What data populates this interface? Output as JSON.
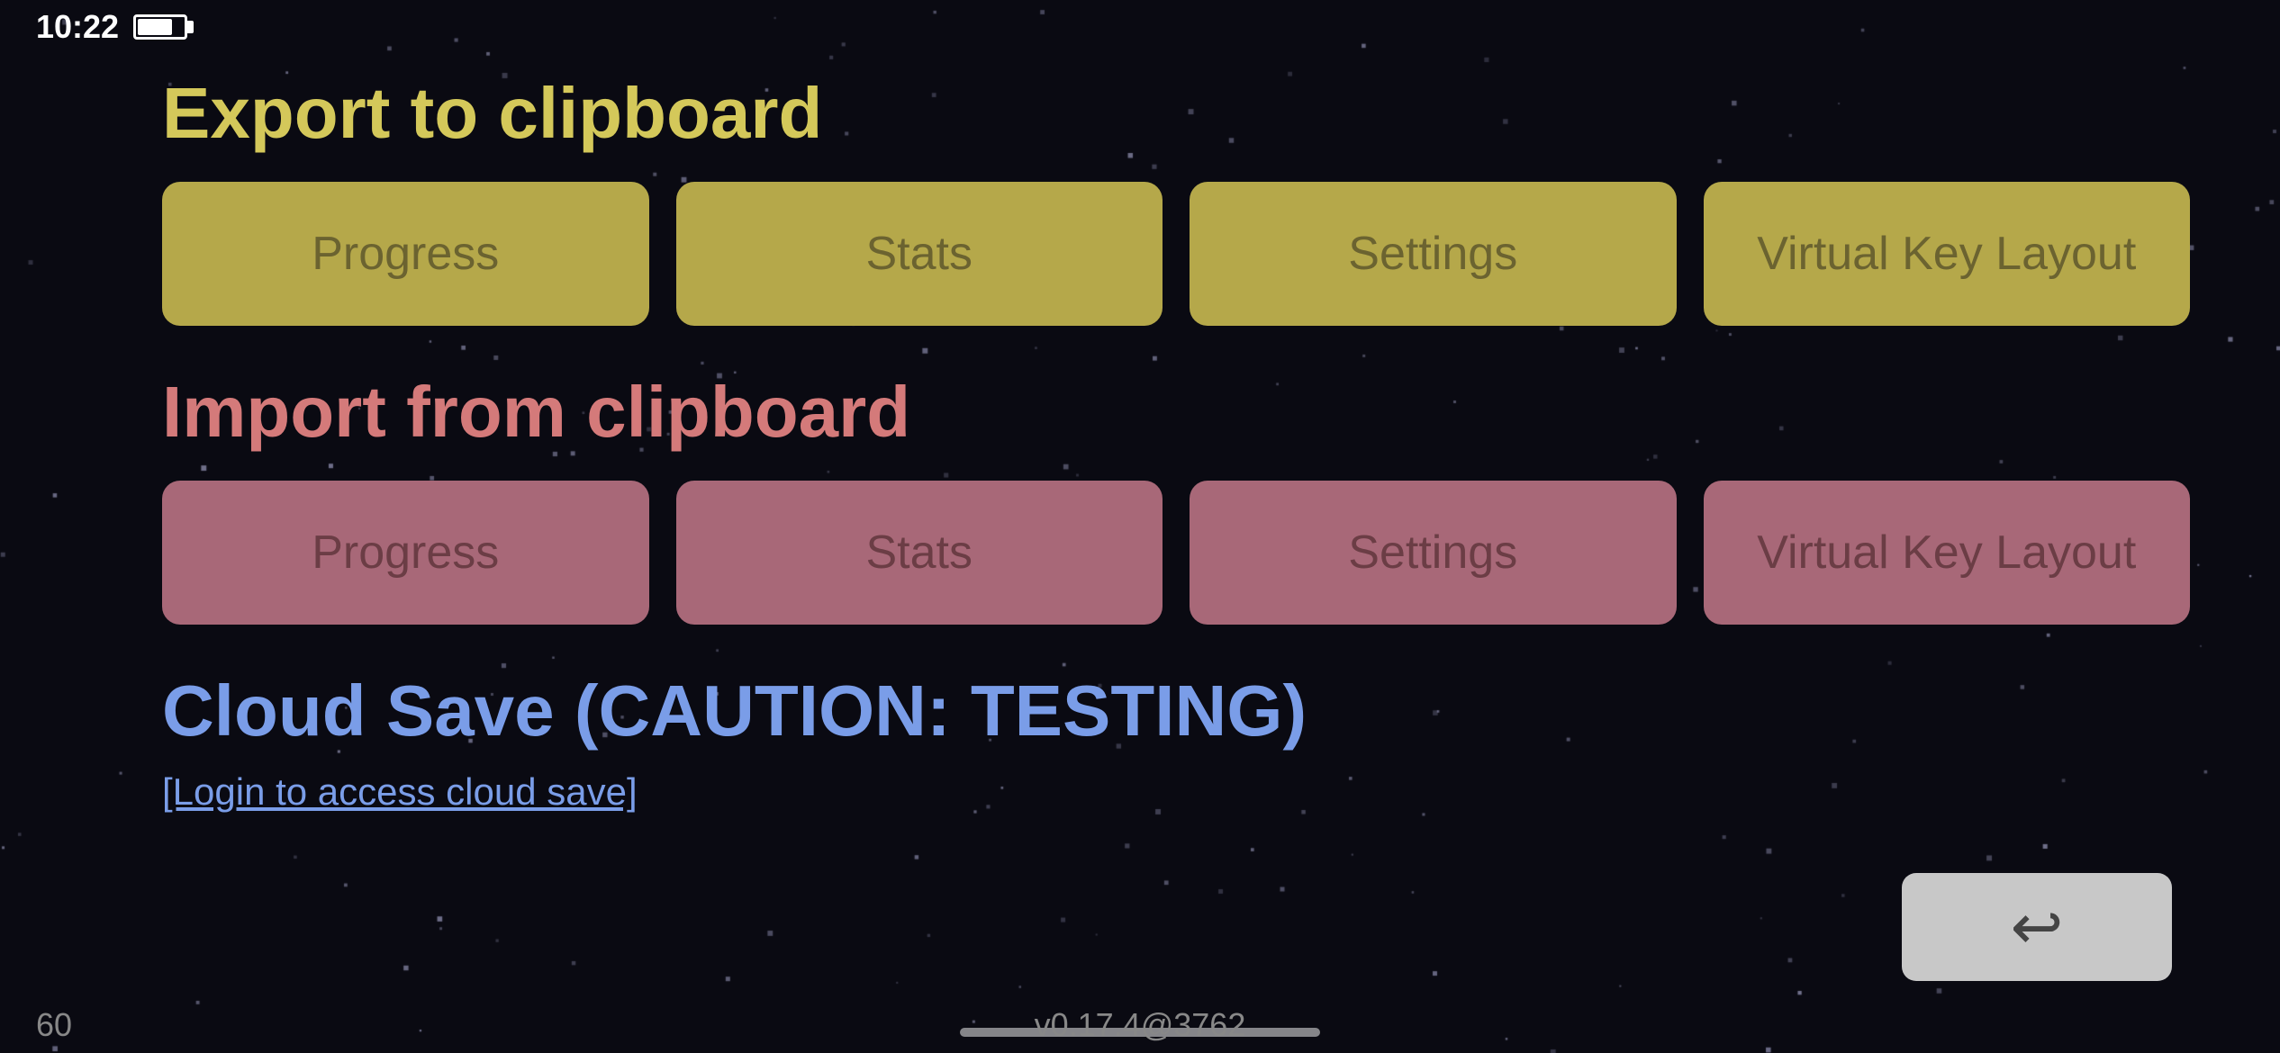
{
  "statusBar": {
    "time": "10:22"
  },
  "exportSection": {
    "title": "Export to clipboard",
    "buttons": [
      {
        "label": "Progress"
      },
      {
        "label": "Stats"
      },
      {
        "label": "Settings"
      },
      {
        "label": "Virtual Key Layout"
      }
    ]
  },
  "importSection": {
    "title": "Import from clipboard",
    "buttons": [
      {
        "label": "Progress"
      },
      {
        "label": "Stats"
      },
      {
        "label": "Settings"
      },
      {
        "label": "Virtual Key Layout"
      }
    ]
  },
  "cloudSection": {
    "title": "Cloud Save (CAUTION: TESTING)",
    "loginText": "[Login to access cloud save]"
  },
  "backButton": {
    "arrowSymbol": "↩"
  },
  "bottomBar": {
    "leftNumber": "60",
    "version": "v0.17.4@3762"
  },
  "colors": {
    "exportTitle": "#d4c85a",
    "importTitle": "#d47a7a",
    "cloudTitle": "#7a9de8",
    "exportButton": "#b5a84a",
    "importButton": "#a86878"
  }
}
